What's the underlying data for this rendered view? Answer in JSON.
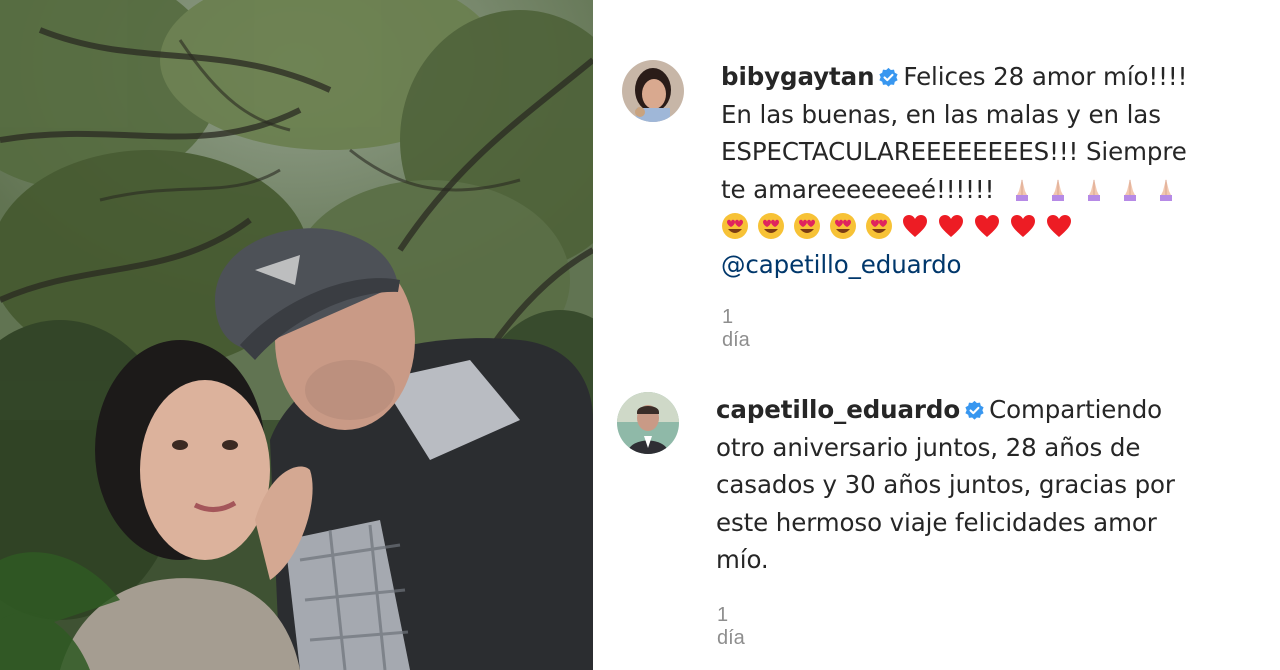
{
  "post": {
    "photo_icon": "couple-selfie-photo"
  },
  "comments": [
    {
      "username": "bibygaytan",
      "verified": true,
      "text_line1": "Felices 28 amor mío!!!!",
      "text_line2": "En las buenas, en las malas y en las",
      "text_line3": "ESPECTACULAREEEEEEEES!!! Siempre",
      "text_line4": "te amareeeeeeeé!!!!!!",
      "emoji_prayer_count": 5,
      "emoji_heart_eyes_count": 5,
      "emoji_heart_count": 5,
      "mention": "@capetillo_eduardo",
      "timestamp": "1 día"
    },
    {
      "username": "capetillo_eduardo",
      "verified": true,
      "text_line1": "Compartiendo",
      "text_line2": "otro aniversario juntos, 28 años de",
      "text_line3": "casados y 30 años juntos, gracias por",
      "text_line4": "este hermoso viaje felicidades amor",
      "text_line5": "mío.",
      "timestamp": "1 día"
    }
  ],
  "colors": {
    "verified_badge": "#3897f0",
    "mention": "#00376b",
    "timestamp": "#8e8e8e",
    "heart": "#ed1c24"
  }
}
